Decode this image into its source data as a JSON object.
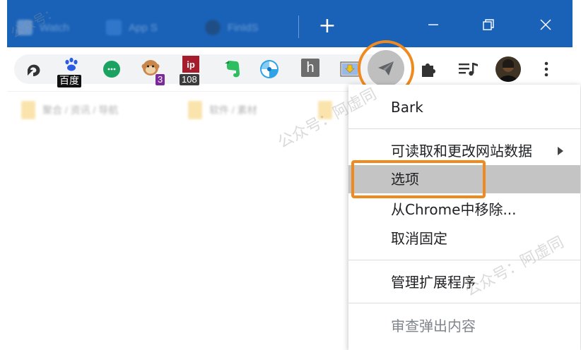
{
  "browser": {
    "tabs": [
      {
        "label": "Watch",
        "icon": "page-icon"
      },
      {
        "label": "App S",
        "icon": "app-icon"
      },
      {
        "label": "FinIdS",
        "icon": "github-icon"
      }
    ],
    "new_tab_label": "+",
    "window_controls": [
      "minimize-icon",
      "restore-icon",
      "close-icon"
    ],
    "titlebar_color": "#1a62b8"
  },
  "extensions": [
    {
      "name": "back-arrow-icon"
    },
    {
      "name": "baidu-icon",
      "label": "百度"
    },
    {
      "name": "chat-icon"
    },
    {
      "name": "monkey-icon",
      "badge": "3",
      "badge_color": "#7b2a99"
    },
    {
      "name": "ip-icon",
      "label": "ip",
      "badge": "108",
      "badge_color": "#3c3c3c"
    },
    {
      "name": "evernote-icon"
    },
    {
      "name": "pinwheel-icon"
    },
    {
      "name": "h-icon",
      "label": "h"
    },
    {
      "name": "download-image-icon"
    },
    {
      "name": "bark-paper-plane-icon"
    },
    {
      "name": "puzzle-icon"
    },
    {
      "name": "media-queue-icon"
    },
    {
      "name": "avatar"
    },
    {
      "name": "more-vert-icon"
    }
  ],
  "bookmarks": [
    {
      "label": "聚合 / 资讯 / 导航"
    },
    {
      "label": "软件 / 素材"
    }
  ],
  "context_menu": {
    "extension_name": "Bark",
    "items": [
      {
        "label": "可读取和更改网站数据",
        "has_submenu": true
      },
      {
        "label": "选项",
        "highlighted": true
      },
      {
        "label": "从Chrome中移除..."
      },
      {
        "label": "取消固定"
      },
      {
        "label": "管理扩展程序"
      },
      {
        "label": "审查弹出内容",
        "disabled": true
      }
    ]
  },
  "watermarks": [
    "公众号：",
    "公众号：阿虚同",
    "公众号：阿虚同"
  ],
  "colors": {
    "highlight_ring": "#ef8a1f",
    "menu_highlight": "#c4c4c4",
    "disabled_text": "#80868b"
  }
}
